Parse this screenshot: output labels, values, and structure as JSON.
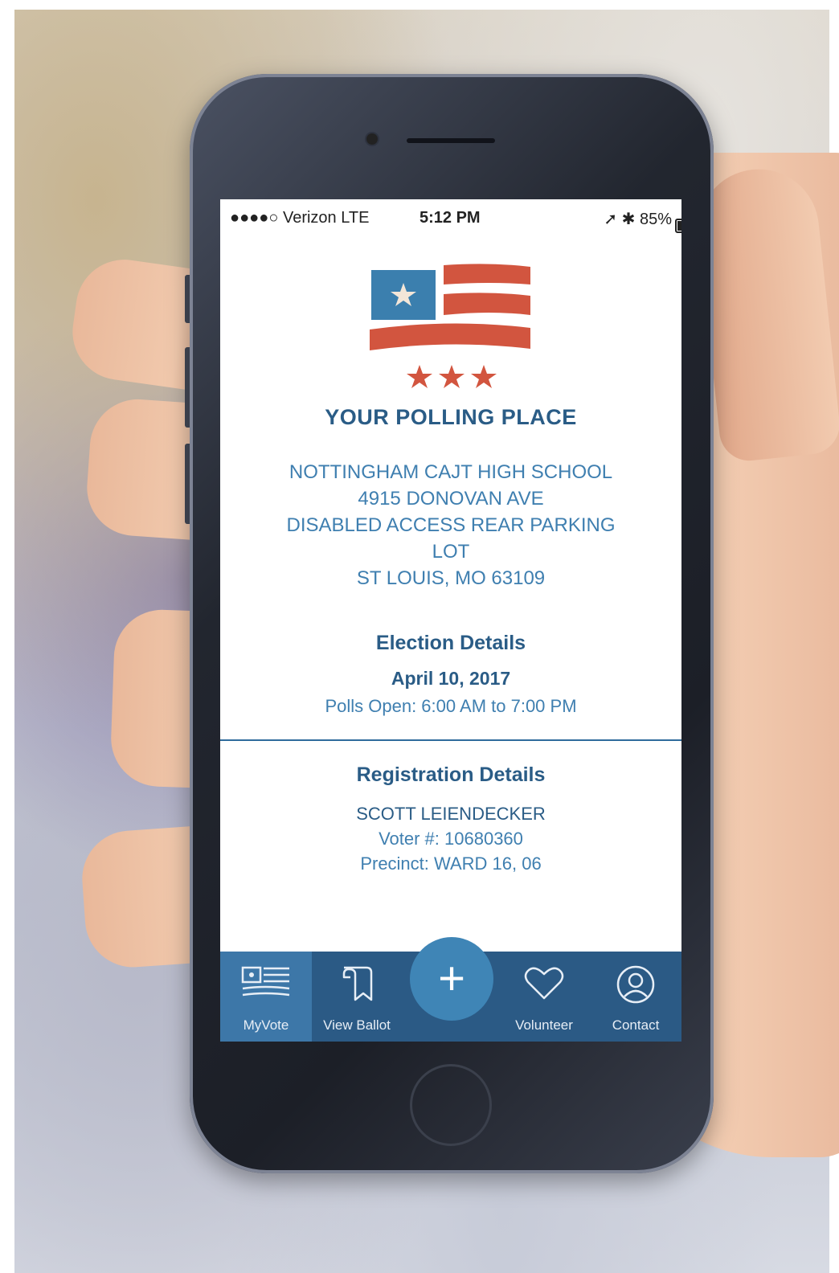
{
  "status_bar": {
    "carrier": "●●●●○ Verizon  LTE",
    "time": "5:12 PM",
    "right": "➚ ✱ 85%"
  },
  "polling": {
    "heading": "YOUR POLLING PLACE",
    "address_lines": [
      "NOTTINGHAM CAJT HIGH SCHOOL",
      "4915 DONOVAN AVE",
      "DISABLED ACCESS REAR PARKING",
      "LOT",
      "ST LOUIS, MO 63109"
    ]
  },
  "election": {
    "title": "Election Details",
    "date": "April 10, 2017",
    "polls": "Polls Open: 6:00 AM to 7:00 PM"
  },
  "registration": {
    "title": "Registration Details",
    "name": "SCOTT LEIENDECKER",
    "voter": "Voter #: 10680360",
    "precinct": "Precinct: WARD 16, 06"
  },
  "tabs": [
    {
      "label": "MyVote",
      "icon": "flag-icon",
      "active": true
    },
    {
      "label": "View Ballot",
      "icon": "ballot-icon",
      "active": false
    },
    {
      "label": "",
      "icon": "plus-icon",
      "active": false
    },
    {
      "label": "Volunteer",
      "icon": "heart-icon",
      "active": false
    },
    {
      "label": "Contact",
      "icon": "user-circle-icon",
      "active": false
    }
  ],
  "fab_symbol": "+",
  "colors": {
    "accent": "#2a5c86",
    "text": "#3f7fb0",
    "tabbar": "#2b5a85",
    "tab_active": "#3d77a8",
    "flag_red": "#d2553f",
    "flag_blue": "#3b7fae"
  }
}
